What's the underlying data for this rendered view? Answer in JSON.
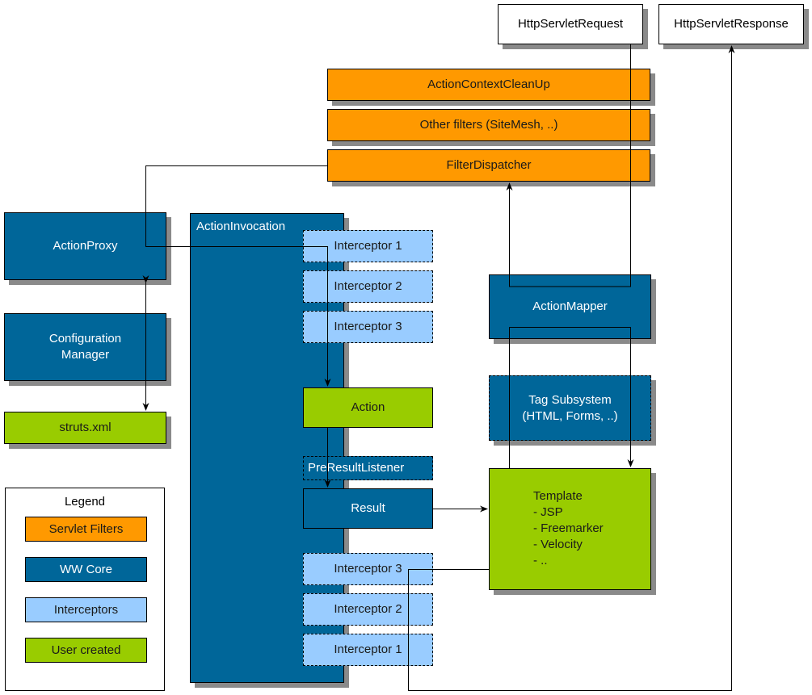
{
  "diagram": {
    "nodes": {
      "http_request": "HttpServletRequest",
      "http_response": "HttpServletResponse",
      "action_context_cleanup": "ActionContextCleanUp",
      "other_filters": "Other filters (SiteMesh, ..)",
      "filter_dispatcher": "FilterDispatcher",
      "action_proxy": "ActionProxy",
      "configuration_manager_line1": "Configuration",
      "configuration_manager_line2": "Manager",
      "struts_xml": "struts.xml",
      "action_invocation": "ActionInvocation",
      "interceptors_in": [
        "Interceptor 1",
        "Interceptor 2",
        "Interceptor 3"
      ],
      "action": "Action",
      "pre_result_listener": "PreResultListener",
      "result": "Result",
      "interceptors_out": [
        "Interceptor 3",
        "Interceptor 2",
        "Interceptor 1"
      ],
      "action_mapper": "ActionMapper",
      "tag_subsystem_line1": "Tag Subsystem",
      "tag_subsystem_line2": "(HTML, Forms, ..)",
      "template": [
        "Template",
        "- JSP",
        "- Freemarker",
        "- Velocity",
        "- .."
      ]
    },
    "legend": {
      "title": "Legend",
      "items": [
        {
          "label": "Servlet Filters",
          "color": "#ff9900"
        },
        {
          "label": "WW Core",
          "color": "#006699"
        },
        {
          "label": "Interceptors",
          "color": "#99ccff"
        },
        {
          "label": "User created",
          "color": "#99cc00"
        }
      ]
    },
    "colors": {
      "servlet_filters": "#ff9900",
      "ww_core": "#006699",
      "interceptors": "#99ccff",
      "user_created": "#99cc00",
      "shadow": "#8a8a8a"
    }
  }
}
